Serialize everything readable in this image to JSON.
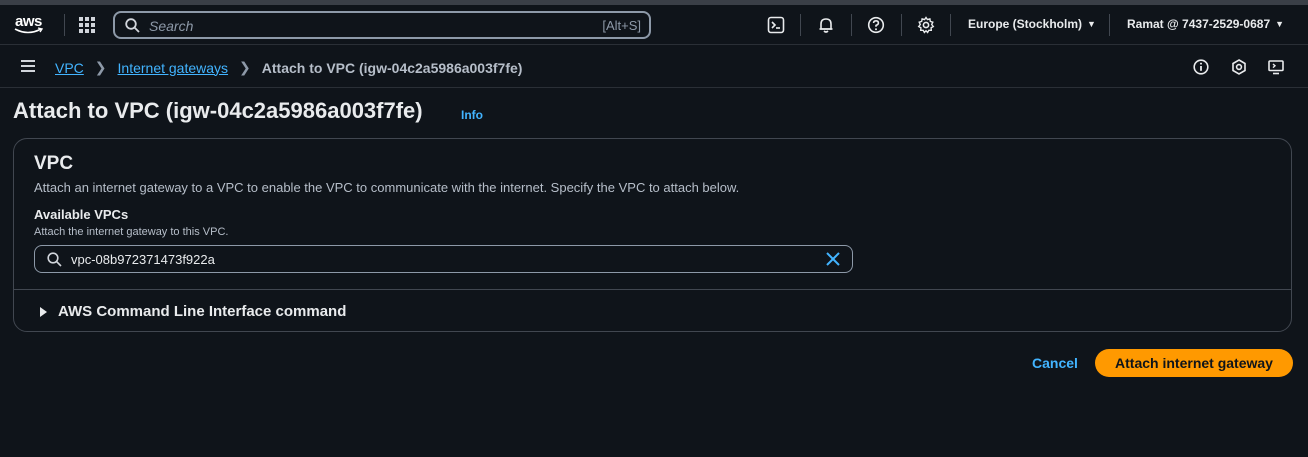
{
  "topnav": {
    "logo_text": "aws",
    "search_placeholder": "Search",
    "search_shortcut": "[Alt+S]",
    "icons": [
      "services-grid-icon",
      "search-icon",
      "cloudshell-icon",
      "notifications-bell-icon",
      "help-icon",
      "settings-gear-icon"
    ],
    "region": "Europe (Stockholm)",
    "account": "Ramat @ 7437-2529-0687"
  },
  "breadcrumb": {
    "items": [
      "VPC",
      "Internet gateways"
    ],
    "current": "Attach to VPC (igw-04c2a5986a003f7fe)"
  },
  "page": {
    "title": "Attach to VPC (igw-04c2a5986a003f7fe)",
    "info_label": "Info"
  },
  "vpc_panel": {
    "heading": "VPC",
    "description": "Attach an internet gateway to a VPC to enable the VPC to communicate with the internet. Specify the VPC to attach below.",
    "field_label": "Available VPCs",
    "field_description": "Attach the internet gateway to this VPC.",
    "field_value": "vpc-08b972371473f922a",
    "cli_expander": "AWS Command Line Interface command"
  },
  "actions": {
    "cancel_label": "Cancel",
    "primary_label": "Attach internet gateway"
  },
  "colors": {
    "background": "#0f141a",
    "link": "#42b4ff",
    "primary_button": "#ff9900"
  }
}
